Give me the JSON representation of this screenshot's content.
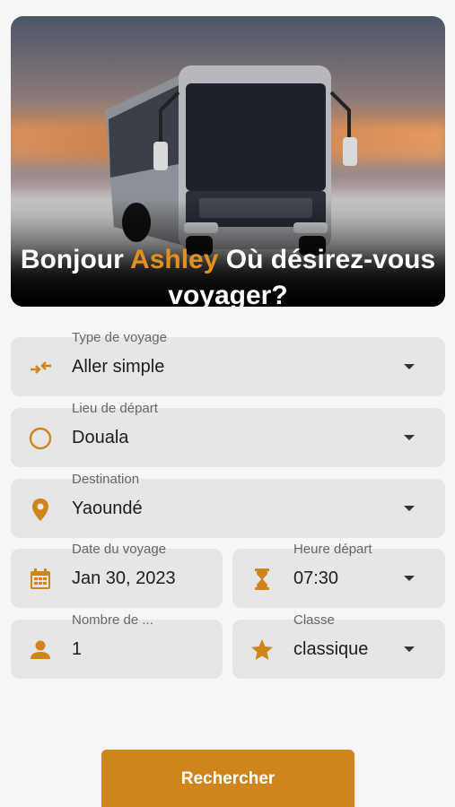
{
  "hero": {
    "greeting": "Bonjour",
    "user_name": "Ashley",
    "question": "Où désirez-vous voyager?"
  },
  "form": {
    "trip_type": {
      "label": "Type de voyage",
      "value": "Aller simple",
      "icon": "swap-arrows-icon"
    },
    "departure": {
      "label": "Lieu de départ",
      "value": "Douala",
      "icon": "circle-icon"
    },
    "destination": {
      "label": "Destination",
      "value": "Yaoundé",
      "icon": "location-pin-icon"
    },
    "travel_date": {
      "label": "Date du voyage",
      "value": "Jan 30, 2023",
      "icon": "calendar-icon"
    },
    "departure_time": {
      "label": "Heure départ",
      "value": "07:30",
      "icon": "hourglass-icon"
    },
    "passengers": {
      "label": "Nombre de ...",
      "value": "1",
      "icon": "person-icon"
    },
    "class": {
      "label": "Classe",
      "value": "classique",
      "icon": "star-icon"
    }
  },
  "actions": {
    "search_label": "Rechercher"
  },
  "colors": {
    "accent": "#d0851b",
    "field_bg": "#e6e6e6",
    "page_bg": "#f6f6f6"
  }
}
